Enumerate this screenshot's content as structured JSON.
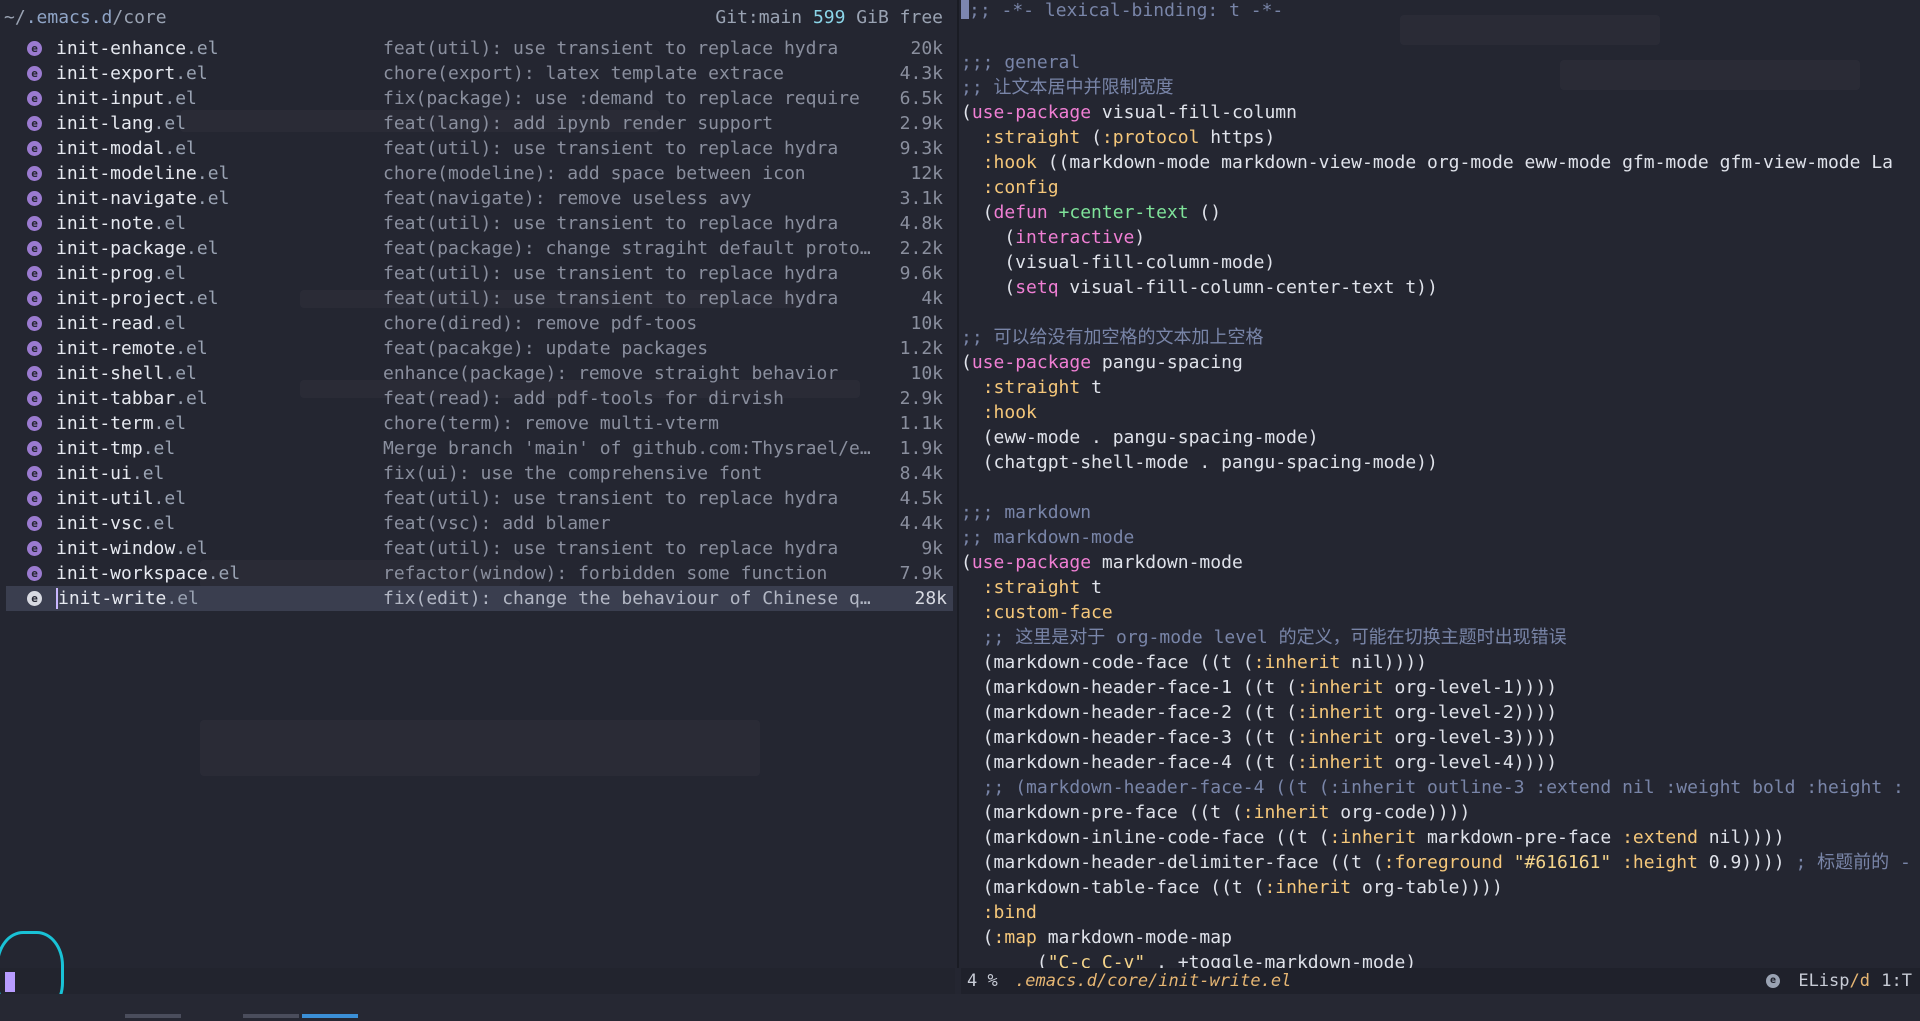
{
  "left_pane": {
    "path_prefix": "~/",
    "path_dir": ".emacs.d",
    "path_sep": "/",
    "path_sub": "core",
    "git_label": "Git:main",
    "free_num": "599",
    "free_unit": "GiB free",
    "file_icon_glyph": "e",
    "files": [
      {
        "name": "init-enhance",
        "ext": ".el",
        "commit": "feat(util): use transient to replace hydra",
        "size": "20k"
      },
      {
        "name": "init-export",
        "ext": ".el",
        "commit": "chore(export): latex template extrace",
        "size": "4.3k"
      },
      {
        "name": "init-input",
        "ext": ".el",
        "commit": "fix(package): use :demand to replace require",
        "size": "6.5k"
      },
      {
        "name": "init-lang",
        "ext": ".el",
        "commit": "feat(lang): add ipynb render support",
        "size": "2.9k"
      },
      {
        "name": "init-modal",
        "ext": ".el",
        "commit": "feat(util): use transient to replace hydra",
        "size": "9.3k"
      },
      {
        "name": "init-modeline",
        "ext": ".el",
        "commit": "chore(modeline): add space between icon",
        "size": "12k"
      },
      {
        "name": "init-navigate",
        "ext": ".el",
        "commit": "feat(navigate): remove useless avy",
        "size": "3.1k"
      },
      {
        "name": "init-note",
        "ext": ".el",
        "commit": "feat(util): use transient to replace hydra",
        "size": "4.8k"
      },
      {
        "name": "init-package",
        "ext": ".el",
        "commit": "feat(package): change stragiht default proto…",
        "size": "2.2k"
      },
      {
        "name": "init-prog",
        "ext": ".el",
        "commit": "feat(util): use transient to replace hydra",
        "size": "9.6k"
      },
      {
        "name": "init-project",
        "ext": ".el",
        "commit": "feat(util): use transient to replace hydra",
        "size": "4k"
      },
      {
        "name": "init-read",
        "ext": ".el",
        "commit": "chore(dired): remove pdf-toos",
        "size": "10k"
      },
      {
        "name": "init-remote",
        "ext": ".el",
        "commit": "feat(pacakge): update packages",
        "size": "1.2k"
      },
      {
        "name": "init-shell",
        "ext": ".el",
        "commit": "enhance(package): remove straight behavior",
        "size": "10k"
      },
      {
        "name": "init-tabbar",
        "ext": ".el",
        "commit": "feat(read): add pdf-tools for dirvish",
        "size": "2.9k"
      },
      {
        "name": "init-term",
        "ext": ".el",
        "commit": "chore(term): remove multi-vterm",
        "size": "1.1k"
      },
      {
        "name": "init-tmp",
        "ext": ".el",
        "commit": "Merge branch 'main' of github.com:Thysrael/e…",
        "size": "1.9k"
      },
      {
        "name": "init-ui",
        "ext": ".el",
        "commit": "fix(ui): use the comprehensive font",
        "size": "8.4k"
      },
      {
        "name": "init-util",
        "ext": ".el",
        "commit": "feat(util): use transient to replace hydra",
        "size": "4.5k"
      },
      {
        "name": "init-vsc",
        "ext": ".el",
        "commit": "feat(vsc): add blamer",
        "size": "4.4k"
      },
      {
        "name": "init-window",
        "ext": ".el",
        "commit": "feat(util): use transient to replace hydra",
        "size": "9k"
      },
      {
        "name": "init-workspace",
        "ext": ".el",
        "commit": "refactor(window): forbidden some function",
        "size": "7.9k"
      },
      {
        "name": "init-write",
        "ext": ".el",
        "commit": "fix(edit): change the behaviour of Chinese q…",
        "size": "28k",
        "selected": true
      }
    ]
  },
  "code_lines": [
    [
      [
        "pt",
        ""
      ],
      [
        "cm",
        ";; -*- lexical-binding: t -*-"
      ]
    ],
    [],
    [
      [
        "cm",
        ";;; general"
      ]
    ],
    [
      [
        "cm",
        ";; 让文本居中并限制宽度"
      ]
    ],
    [
      [
        "par",
        "("
      ],
      [
        "kw",
        "use-package"
      ],
      [
        "t",
        " visual-fill-column"
      ]
    ],
    [
      [
        "t",
        "  "
      ],
      [
        "kk",
        ":straight"
      ],
      [
        "t",
        " ("
      ],
      [
        "kk",
        ":protocol"
      ],
      [
        "t",
        " https)"
      ]
    ],
    [
      [
        "t",
        "  "
      ],
      [
        "kk",
        ":hook"
      ],
      [
        "t",
        " ((markdown-mode markdown-view-mode org-mode eww-mode gfm-mode gfm-view-mode La"
      ]
    ],
    [
      [
        "t",
        "  "
      ],
      [
        "kk",
        ":config"
      ]
    ],
    [
      [
        "t",
        "  ("
      ],
      [
        "kw",
        "defun"
      ],
      [
        "t",
        " "
      ],
      [
        "fn",
        "+center-text"
      ],
      [
        "t",
        " ()"
      ]
    ],
    [
      [
        "t",
        "    ("
      ],
      [
        "kw",
        "interactive"
      ],
      [
        "t",
        ")"
      ]
    ],
    [
      [
        "t",
        "    (visual-fill-column-mode)"
      ]
    ],
    [
      [
        "t",
        "    ("
      ],
      [
        "kw",
        "setq"
      ],
      [
        "t",
        " visual-fill-column-center-text t))"
      ]
    ],
    [],
    [
      [
        "cm",
        ";; 可以给没有加空格的文本加上空格"
      ]
    ],
    [
      [
        "par",
        "("
      ],
      [
        "kw",
        "use-package"
      ],
      [
        "t",
        " pangu-spacing"
      ]
    ],
    [
      [
        "t",
        "  "
      ],
      [
        "kk",
        ":straight"
      ],
      [
        "t",
        " t"
      ]
    ],
    [
      [
        "t",
        "  "
      ],
      [
        "kk",
        ":hook"
      ]
    ],
    [
      [
        "t",
        "  (eww-mode . pangu-spacing-mode)"
      ]
    ],
    [
      [
        "t",
        "  (chatgpt-shell-mode . pangu-spacing-mode))"
      ]
    ],
    [],
    [
      [
        "cm",
        ";;; markdown"
      ]
    ],
    [
      [
        "cm",
        ";; markdown-mode"
      ]
    ],
    [
      [
        "par",
        "("
      ],
      [
        "kw",
        "use-package"
      ],
      [
        "t",
        " markdown-mode"
      ]
    ],
    [
      [
        "t",
        "  "
      ],
      [
        "kk",
        ":straight"
      ],
      [
        "t",
        " t"
      ]
    ],
    [
      [
        "t",
        "  "
      ],
      [
        "kk",
        ":custom-face"
      ]
    ],
    [
      [
        "t",
        "  "
      ],
      [
        "cm",
        ";; 这里是对于 org-mode level 的定义，可能在切换主题时出现错误"
      ]
    ],
    [
      [
        "t",
        "  (markdown-code-face ((t ("
      ],
      [
        "kk",
        ":inherit"
      ],
      [
        "t",
        " nil))))"
      ]
    ],
    [
      [
        "t",
        "  (markdown-header-face-1 ((t ("
      ],
      [
        "kk",
        ":inherit"
      ],
      [
        "t",
        " org-level-1))))"
      ]
    ],
    [
      [
        "t",
        "  (markdown-header-face-2 ((t ("
      ],
      [
        "kk",
        ":inherit"
      ],
      [
        "t",
        " org-level-2))))"
      ]
    ],
    [
      [
        "t",
        "  (markdown-header-face-3 ((t ("
      ],
      [
        "kk",
        ":inherit"
      ],
      [
        "t",
        " org-level-3))))"
      ]
    ],
    [
      [
        "t",
        "  (markdown-header-face-4 ((t ("
      ],
      [
        "kk",
        ":inherit"
      ],
      [
        "t",
        " org-level-4))))"
      ]
    ],
    [
      [
        "t",
        "  "
      ],
      [
        "cm",
        ";; (markdown-header-face-4 ((t (:inherit outline-3 :extend nil :weight bold :height :"
      ]
    ],
    [
      [
        "t",
        "  (markdown-pre-face ((t ("
      ],
      [
        "kk",
        ":inherit"
      ],
      [
        "t",
        " org-code))))"
      ]
    ],
    [
      [
        "t",
        "  (markdown-inline-code-face ((t ("
      ],
      [
        "kk",
        ":inherit"
      ],
      [
        "t",
        " markdown-pre-face "
      ],
      [
        "kk",
        ":extend"
      ],
      [
        "t",
        " nil))))"
      ]
    ],
    [
      [
        "t",
        "  (markdown-header-delimiter-face ((t ("
      ],
      [
        "kk",
        ":foreground"
      ],
      [
        "t",
        " "
      ],
      [
        "str",
        "\"#616161\""
      ],
      [
        "t",
        " "
      ],
      [
        "kk",
        ":height"
      ],
      [
        "t",
        " 0.9)))) "
      ],
      [
        "cm",
        "; 标题前的 -"
      ]
    ],
    [
      [
        "t",
        "  (markdown-table-face ((t ("
      ],
      [
        "kk",
        ":inherit"
      ],
      [
        "t",
        " org-table))))"
      ]
    ],
    [
      [
        "t",
        "  "
      ],
      [
        "kk",
        ":bind"
      ]
    ],
    [
      [
        "t",
        "  ("
      ],
      [
        "kk",
        ":map"
      ],
      [
        "t",
        " markdown-mode-map"
      ]
    ],
    [
      [
        "t",
        "       ("
      ],
      [
        "str",
        "\"C-c C-v\""
      ],
      [
        "t",
        " . +toggle-markdown-mode)"
      ]
    ]
  ],
  "modeline": {
    "percent": "4 %",
    "buffer": ".emacs.d/core/init-write.el",
    "icon_glyph": "e",
    "mode_name": "ELisp",
    "mode_suffix": "/d",
    "position": "1:T"
  }
}
